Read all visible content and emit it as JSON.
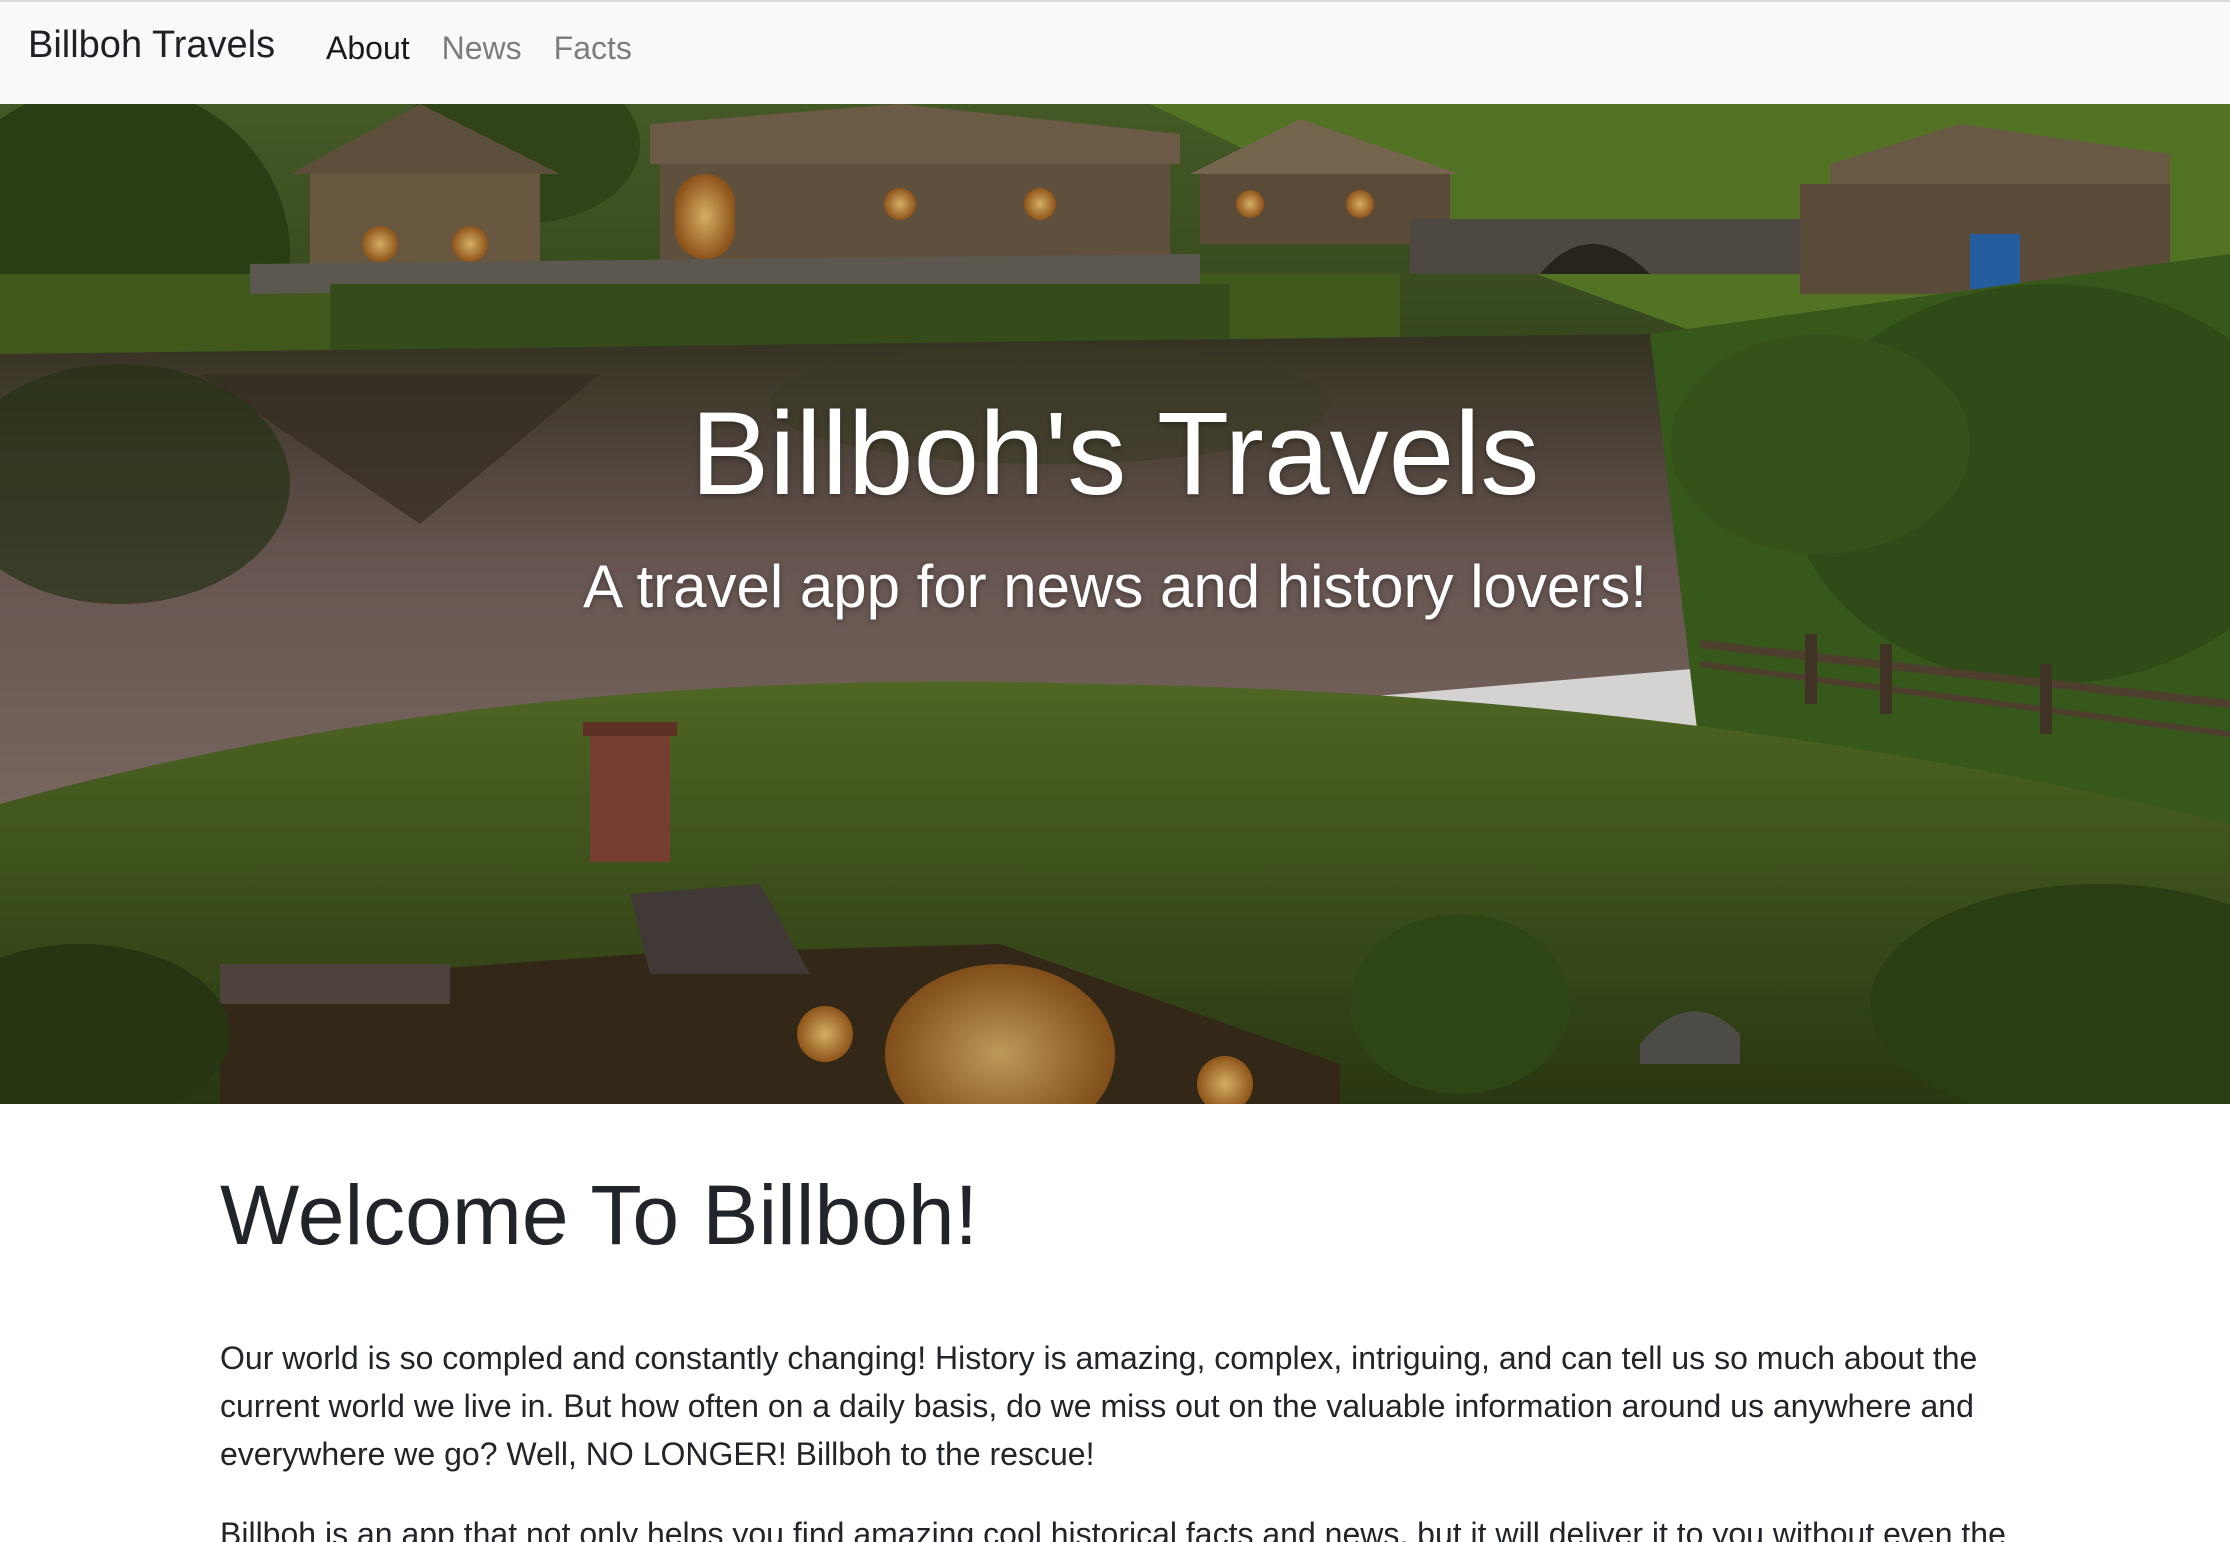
{
  "navbar": {
    "brand": "Billboh Travels",
    "links": [
      {
        "label": "About",
        "active": true
      },
      {
        "label": "News",
        "active": false
      },
      {
        "label": "Facts",
        "active": false
      }
    ]
  },
  "hero": {
    "title": "Billboh's Travels",
    "subtitle": "A travel app for news and history lovers!"
  },
  "main": {
    "heading": "Welcome To Billboh!",
    "paragraph1": "Our world is so compled and constantly changing! History is amazing, complex, intriguing, and can tell us so much about the current world we live in. But how often on a daily basis, do we miss out on the valuable information around us anywhere and everywhere we go? Well, NO LONGER! Billboh to the rescue!",
    "paragraph2": "Billboh is an app that not only helps you find amazing cool historical facts and news, but it will deliver it to you without even the"
  },
  "colors": {
    "navbar_bg": "#f8f9fa",
    "text_dark": "#212529",
    "grass": "#3d5a1e",
    "water": "#6b5a55"
  }
}
